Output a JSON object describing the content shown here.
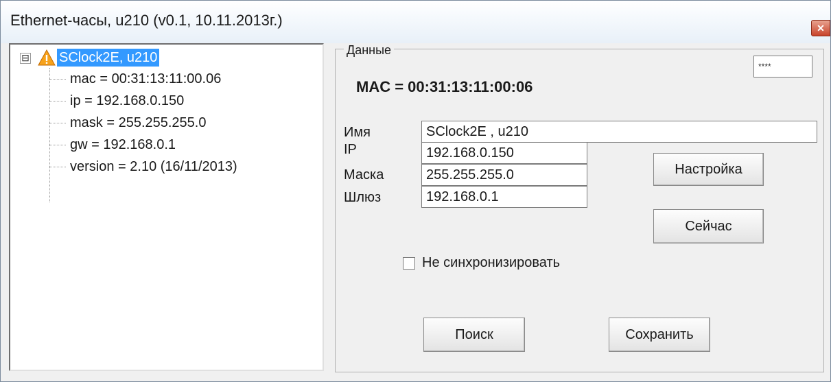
{
  "window": {
    "title": "Ethernet-часы, u210 (v0.1, 10.11.2013г.)",
    "close_icon": "close-icon"
  },
  "tree": {
    "root_label": "SClock2E, u210",
    "toggle": "⊟",
    "root_icon": "warning-icon",
    "items": [
      "mac = 00:31:13:11:00.06",
      "ip = 192.168.0.150",
      "mask = 255.255.255.0",
      "gw = 192.168.0.1",
      "version = 2.10 (16/11/2013)"
    ]
  },
  "details": {
    "group_label": "Данные",
    "password_value": "****",
    "mac_text": "MAC = 00:31:13:11:00:06",
    "labels": {
      "name": "Имя",
      "ip": "IP",
      "mask": "Маска",
      "gateway": "Шлюз"
    },
    "values": {
      "name": "SClock2E , u210",
      "ip": "192.168.0.150",
      "mask": "255.255.255.0",
      "gateway": "192.168.0.1"
    },
    "buttons": {
      "settings": "Настройка",
      "now": "Сейчас",
      "search": "Поиск",
      "save": "Сохранить"
    },
    "checkbox_label": "Не синхронизировать",
    "checkbox_checked": false
  }
}
